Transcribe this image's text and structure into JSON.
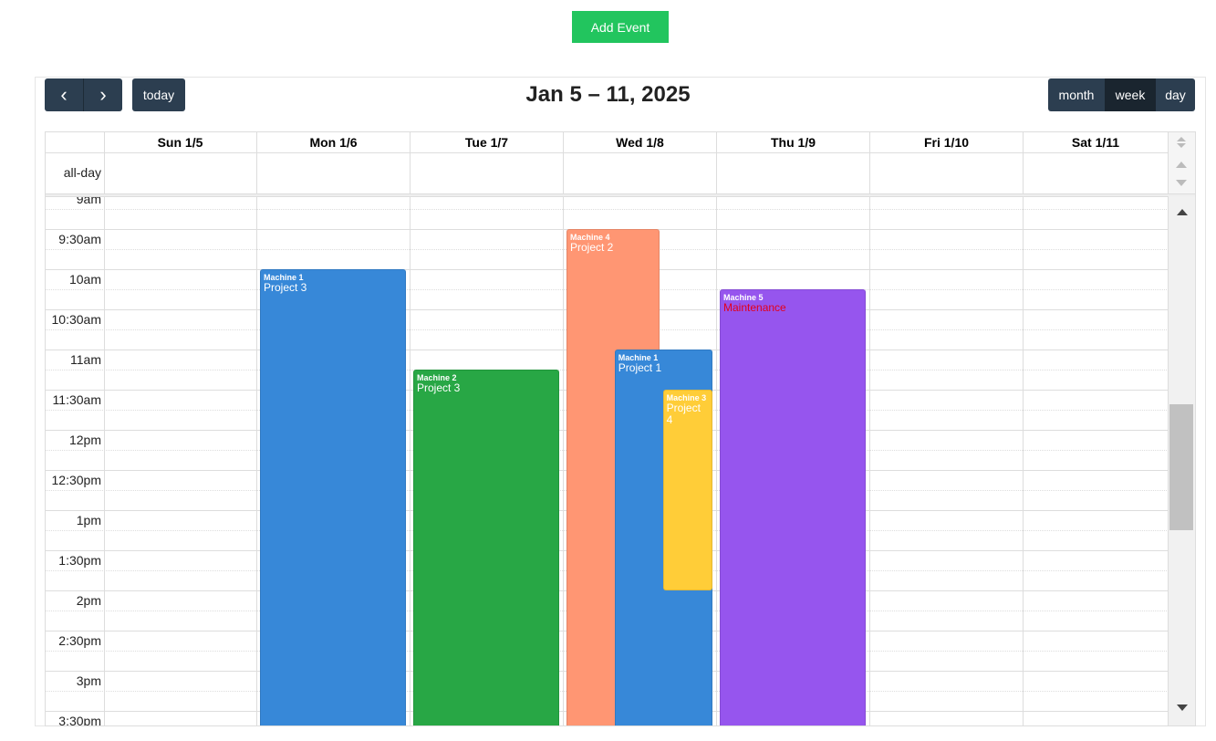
{
  "add_event": "Add Event",
  "toolbar": {
    "prev": "‹",
    "next": "›",
    "today": "today",
    "title": "Jan 5 – 11, 2025",
    "views": [
      "month",
      "week",
      "day"
    ],
    "active_view": "week"
  },
  "days": [
    "Sun 1/5",
    "Mon 1/6",
    "Tue 1/7",
    "Wed 1/8",
    "Thu 1/9",
    "Fri 1/10",
    "Sat 1/11"
  ],
  "all_day": "all-day",
  "times": [
    "9am",
    "9:30am",
    "10am",
    "10:30am",
    "11am",
    "11:30am",
    "12pm",
    "12:30pm",
    "1pm",
    "1:30pm",
    "2pm",
    "2:30pm",
    "3pm",
    "3:30pm"
  ],
  "events": [
    {
      "machine": "Machine 1",
      "title": "Project 3",
      "day": 1,
      "start": 10,
      "end": 16,
      "color": "#3788d8",
      "title_color": "#ffffff",
      "lane": [
        0,
        1
      ]
    },
    {
      "machine": "Machine 2",
      "title": "Project 3",
      "day": 2,
      "start": 11.25,
      "end": 16,
      "color": "#28a745",
      "title_color": "#ffffff",
      "lane": [
        0,
        1
      ]
    },
    {
      "machine": "Machine 4",
      "title": "Project 2",
      "day": 3,
      "start": 9.5,
      "end": 16,
      "color": "#ff9673",
      "title_color": "#ffffff",
      "lane": [
        0,
        0.64
      ]
    },
    {
      "machine": "Machine 1",
      "title": "Project 1",
      "day": 3,
      "start": 11,
      "end": 16,
      "color": "#3788d8",
      "title_color": "#ffffff",
      "lane": [
        0.33,
        1
      ]
    },
    {
      "machine": "Machine 3",
      "title": "Project 4",
      "day": 3,
      "start": 11.5,
      "end": 14,
      "color": "#ffcd38",
      "title_color": "#ffffff",
      "lane": [
        0.66,
        1
      ]
    },
    {
      "machine": "Machine 5",
      "title": "Maintenance",
      "day": 4,
      "start": 10.25,
      "end": 16,
      "color": "#9655ee",
      "title_color": "#e3001b",
      "lane": [
        0,
        1
      ]
    }
  ]
}
